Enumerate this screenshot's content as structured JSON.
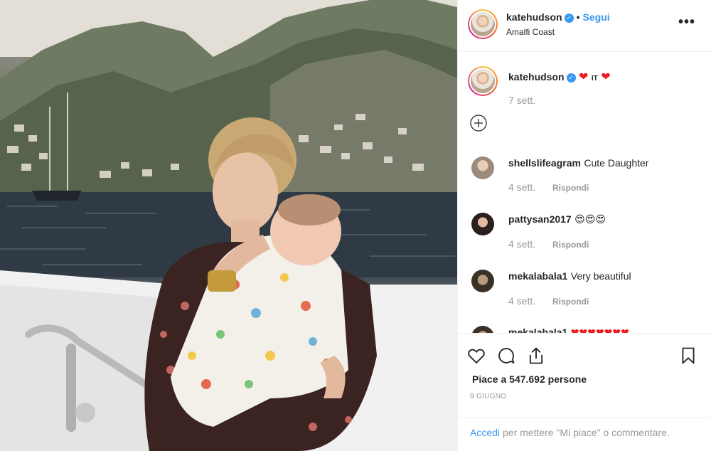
{
  "post": {
    "username": "katehudson",
    "follow_label": "Segui",
    "location": "Amalfi Coast",
    "caption_username": "katehudson",
    "caption_text": "IT",
    "caption_time": "7 sett.",
    "likes_label": "Piace a 547.692 persone",
    "date_label": "9 GIUGNO",
    "login_link": "Accedi",
    "login_rest": "per mettere \"Mi piace\" o commentare."
  },
  "comments": [
    {
      "username": "shellslifeagram",
      "text": "Cute Daughter",
      "time": "4 sett.",
      "reply": "Rispondi"
    },
    {
      "username": "pattysan2017",
      "text": "😍😍😍",
      "time": "4 sett.",
      "reply": "Rispondi"
    },
    {
      "username": "mekalabala1",
      "text": "Very beautiful",
      "time": "4 sett.",
      "reply": "Rispondi"
    },
    {
      "username": "mekalabala1",
      "text": "❤❤❤❤❤❤❤",
      "time": "",
      "reply": ""
    }
  ],
  "icons": {
    "more": "more-options-icon",
    "verified": "verified-badge-icon",
    "load_more": "load-more-comments-icon",
    "like": "heart-icon",
    "comment": "comment-icon",
    "share": "share-icon",
    "save": "bookmark-icon"
  },
  "colors": {
    "accent": "#3897f0",
    "muted": "#999999",
    "text": "#262626",
    "heart": "#ed1c24"
  }
}
